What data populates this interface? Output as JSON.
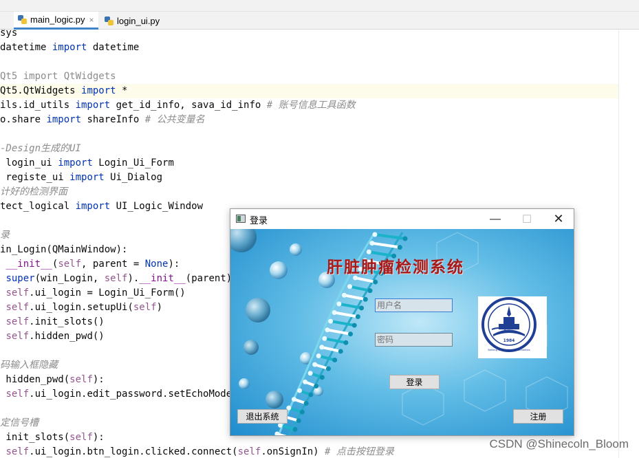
{
  "tabs": [
    {
      "label": "main_logic.py",
      "active": true
    },
    {
      "label": "login_ui.py",
      "active": false
    }
  ],
  "close_glyph": "×",
  "code_lines": [
    {
      "parts": [
        {
          "t": "sys",
          "c": ""
        }
      ]
    },
    {
      "parts": [
        {
          "t": "datetime ",
          "c": ""
        },
        {
          "t": "import",
          "c": "kw"
        },
        {
          "t": " datetime",
          "c": ""
        }
      ]
    },
    {
      "parts": []
    },
    {
      "parts": [
        {
          "t": "Qt5 import QtWidgets",
          "c": "dim"
        }
      ]
    },
    {
      "parts": [
        {
          "t": "Qt5.QtWidgets ",
          "c": ""
        },
        {
          "t": "import",
          "c": "kw"
        },
        {
          "t": " *",
          "c": ""
        }
      ],
      "highlight": true
    },
    {
      "parts": [
        {
          "t": "ils.id_utils ",
          "c": ""
        },
        {
          "t": "import",
          "c": "kw"
        },
        {
          "t": " get_id_info, sava_id_info ",
          "c": ""
        },
        {
          "t": "# 账号信息工具函数",
          "c": "cm"
        }
      ]
    },
    {
      "parts": [
        {
          "t": "o.share ",
          "c": ""
        },
        {
          "t": "import",
          "c": "kw"
        },
        {
          "t": " shareInfo ",
          "c": ""
        },
        {
          "t": "# 公共变量名",
          "c": "cm"
        }
      ]
    },
    {
      "parts": []
    },
    {
      "parts": [
        {
          "t": "-Design生成的UI",
          "c": "cm"
        }
      ]
    },
    {
      "parts": [
        {
          "t": " login_ui ",
          "c": ""
        },
        {
          "t": "import",
          "c": "kw"
        },
        {
          "t": " Login_Ui_Form",
          "c": ""
        }
      ]
    },
    {
      "parts": [
        {
          "t": " registe_ui ",
          "c": ""
        },
        {
          "t": "import",
          "c": "kw"
        },
        {
          "t": " Ui_Dialog",
          "c": ""
        }
      ]
    },
    {
      "parts": [
        {
          "t": "计好的检测界面",
          "c": "cm"
        }
      ]
    },
    {
      "parts": [
        {
          "t": "tect_logical ",
          "c": ""
        },
        {
          "t": "import",
          "c": "kw"
        },
        {
          "t": " UI_Logic_Window",
          "c": ""
        }
      ]
    },
    {
      "parts": []
    },
    {
      "parts": [
        {
          "t": "录",
          "c": "cm"
        }
      ]
    },
    {
      "parts": [
        {
          "t": "in_Login(QMainWindow):",
          "c": ""
        }
      ]
    },
    {
      "parts": [
        {
          "t": " ",
          "c": ""
        },
        {
          "t": "__init__",
          "c": "und"
        },
        {
          "t": "(",
          "c": ""
        },
        {
          "t": "self",
          "c": "self"
        },
        {
          "t": ", parent = ",
          "c": ""
        },
        {
          "t": "None",
          "c": "kw"
        },
        {
          "t": "):",
          "c": ""
        }
      ]
    },
    {
      "parts": [
        {
          "t": " ",
          "c": ""
        },
        {
          "t": "super",
          "c": "kw"
        },
        {
          "t": "(win_Login, ",
          "c": ""
        },
        {
          "t": "self",
          "c": "self"
        },
        {
          "t": ").",
          "c": ""
        },
        {
          "t": "__init__",
          "c": "und"
        },
        {
          "t": "(parent)",
          "c": ""
        }
      ]
    },
    {
      "parts": [
        {
          "t": " ",
          "c": ""
        },
        {
          "t": "self",
          "c": "self"
        },
        {
          "t": ".ui_login = Login_Ui_Form()",
          "c": ""
        }
      ]
    },
    {
      "parts": [
        {
          "t": " ",
          "c": ""
        },
        {
          "t": "self",
          "c": "self"
        },
        {
          "t": ".ui_login.setupUi(",
          "c": ""
        },
        {
          "t": "self",
          "c": "self"
        },
        {
          "t": ")",
          "c": ""
        }
      ]
    },
    {
      "parts": [
        {
          "t": " ",
          "c": ""
        },
        {
          "t": "self",
          "c": "self"
        },
        {
          "t": ".init_slots()",
          "c": ""
        }
      ]
    },
    {
      "parts": [
        {
          "t": " ",
          "c": ""
        },
        {
          "t": "self",
          "c": "self"
        },
        {
          "t": ".hidden_pwd()",
          "c": ""
        }
      ]
    },
    {
      "parts": []
    },
    {
      "parts": [
        {
          "t": "码输入框隐藏",
          "c": "cm"
        }
      ]
    },
    {
      "parts": [
        {
          "t": " hidden_pwd(",
          "c": ""
        },
        {
          "t": "self",
          "c": "self"
        },
        {
          "t": "):",
          "c": ""
        }
      ]
    },
    {
      "parts": [
        {
          "t": " ",
          "c": ""
        },
        {
          "t": "self",
          "c": "self"
        },
        {
          "t": ".ui_login.edit_password.setEchoMode(QL",
          "c": ""
        }
      ]
    },
    {
      "parts": []
    },
    {
      "parts": [
        {
          "t": "定信号槽",
          "c": "cm"
        }
      ]
    },
    {
      "parts": [
        {
          "t": " init_slots(",
          "c": ""
        },
        {
          "t": "self",
          "c": "self"
        },
        {
          "t": "):",
          "c": ""
        }
      ]
    },
    {
      "parts": [
        {
          "t": " ",
          "c": ""
        },
        {
          "t": "self",
          "c": "self"
        },
        {
          "t": ".ui_login.btn_login.clicked.connect(",
          "c": ""
        },
        {
          "t": "self",
          "c": "self"
        },
        {
          "t": ".onSignIn) ",
          "c": ""
        },
        {
          "t": "# 点击按钮登录",
          "c": "cm"
        }
      ]
    }
  ],
  "login_window": {
    "title": "登录",
    "minimize_glyph": "—",
    "maximize_glyph": "☐",
    "close_glyph": "✕",
    "heading": "肝脏肿瘤检测系统",
    "username_placeholder": "用户名",
    "password_placeholder": "密码",
    "login_button": "登录",
    "exit_button": "退出系统",
    "register_button": "注册"
  },
  "logo": {
    "year": "1984",
    "motto": "Beifang University of Nationalities"
  },
  "watermark": "CSDN @Shinecoln_Bloom",
  "colors": {
    "keyword": "#0033b3",
    "self": "#94558d",
    "comment": "#8c8c8c",
    "heading": "#a51b1b",
    "tab_accent": "#4083c9",
    "logo_blue": "#1f3f95"
  }
}
